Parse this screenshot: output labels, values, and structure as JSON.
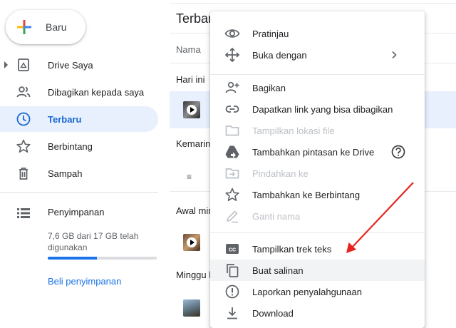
{
  "new_button": {
    "label": "Baru"
  },
  "sidebar": {
    "items": [
      {
        "label": "Drive Saya",
        "icon": "drive-icon"
      },
      {
        "label": "Dibagikan kepada saya",
        "icon": "people-icon"
      },
      {
        "label": "Terbaru",
        "icon": "clock-icon",
        "active": true
      },
      {
        "label": "Berbintang",
        "icon": "star-icon"
      },
      {
        "label": "Sampah",
        "icon": "trash-icon"
      }
    ],
    "storage": {
      "title": "Penyimpanan",
      "usage_text": "7,6 GB dari 17 GB telah digunakan",
      "used_fraction": 0.45,
      "buy_link": "Beli penyimpanan"
    }
  },
  "main": {
    "title": "Terbaru",
    "column_name": "Nama",
    "groups": [
      "Hari ini",
      "Kemarin",
      "Awal minggu",
      "Minggu lalu"
    ]
  },
  "context_menu": {
    "items": [
      {
        "label": "Pratinjau",
        "icon": "eye-icon",
        "disabled": false
      },
      {
        "label": "Buka dengan",
        "icon": "move-arrows-icon",
        "disabled": false,
        "submenu": true
      },
      {
        "label": "Bagikan",
        "icon": "person-add-icon",
        "disabled": false
      },
      {
        "label": "Dapatkan link yang bisa dibagikan",
        "icon": "link-icon",
        "disabled": false
      },
      {
        "label": "Tampilkan lokasi file",
        "icon": "folder-icon",
        "disabled": true
      },
      {
        "label": "Tambahkan pintasan ke Drive",
        "icon": "drive-shortcut-icon",
        "disabled": false,
        "help": true
      },
      {
        "label": "Pindahkan ke",
        "icon": "move-to-folder-icon",
        "disabled": true
      },
      {
        "label": "Tambahkan ke Berbintang",
        "icon": "star-icon",
        "disabled": false
      },
      {
        "label": "Ganti nama",
        "icon": "pencil-icon",
        "disabled": true
      },
      {
        "label": "Tampilkan trek teks",
        "icon": "closed-caption-icon",
        "disabled": false
      },
      {
        "label": "Buat salinan",
        "icon": "copy-icon",
        "disabled": false,
        "hovered": true
      },
      {
        "label": "Laporkan penyalahgunaan",
        "icon": "report-icon",
        "disabled": false
      },
      {
        "label": "Download",
        "icon": "download-icon",
        "disabled": false
      }
    ]
  },
  "annotation": {
    "color": "#e8231f",
    "points_to": "Buat salinan"
  },
  "colors": {
    "accent": "#1a73e8",
    "active_bg": "#e8f0fe",
    "disabled_text": "#bdc1c6"
  }
}
